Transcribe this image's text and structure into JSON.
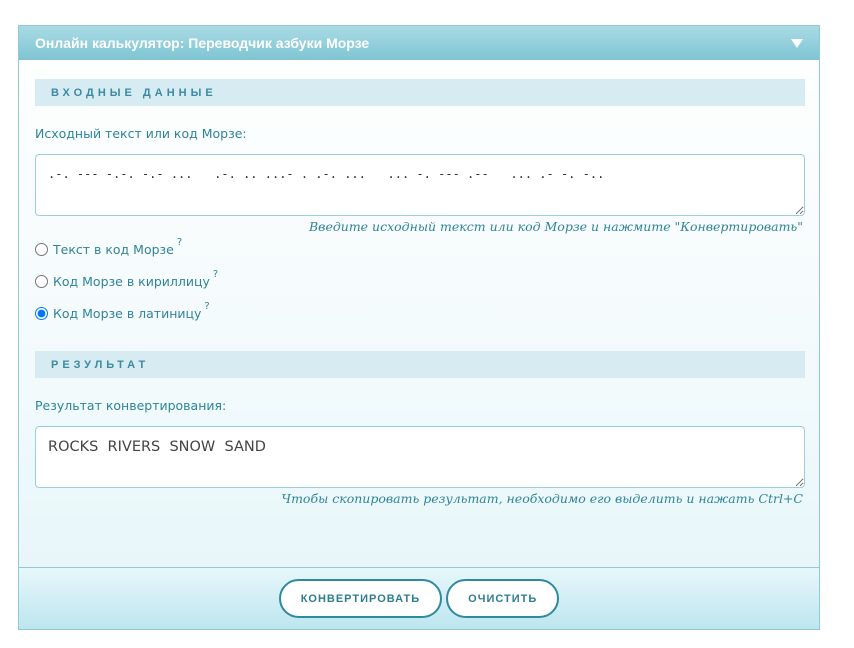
{
  "header": {
    "title": "Онлайн калькулятор: Переводчик азбуки Морзе",
    "collapse_icon": "chevron-down-icon"
  },
  "input_section": {
    "heading": "ВХОДНЫЕ ДАННЫЕ",
    "field_label": "Исходный текст или код Морзе:",
    "field_value": ".-. --- -.-. -.- ...   .-. .. ...- . .-. ...   ... -. --- .--   ... .- -. -..",
    "hint": "Введите исходный текст или код Морзе и нажмите \"Конвертировать\""
  },
  "options": [
    {
      "label": "Текст в код Морзе",
      "help": "?",
      "checked": false
    },
    {
      "label": "Код Морзе в кириллицу",
      "help": "?",
      "checked": false
    },
    {
      "label": "Код Морзе в латиницу",
      "help": "?",
      "checked": true
    }
  ],
  "result_section": {
    "heading": "РЕЗУЛЬТАТ",
    "field_label": "Результат конвертирования:",
    "field_value": "ROCKS  RIVERS  SNOW  SAND",
    "hint": "Чтобы скопировать результат, необходимо его выделить и нажать Ctrl+C"
  },
  "footer": {
    "convert_label": "КОНВЕРТИРОВАТЬ",
    "clear_label": "ОЧИСТИТЬ"
  },
  "colors": {
    "accent": "#2e8a9c",
    "header": "#8fcfdc",
    "section_bar": "#d7ecf2"
  }
}
